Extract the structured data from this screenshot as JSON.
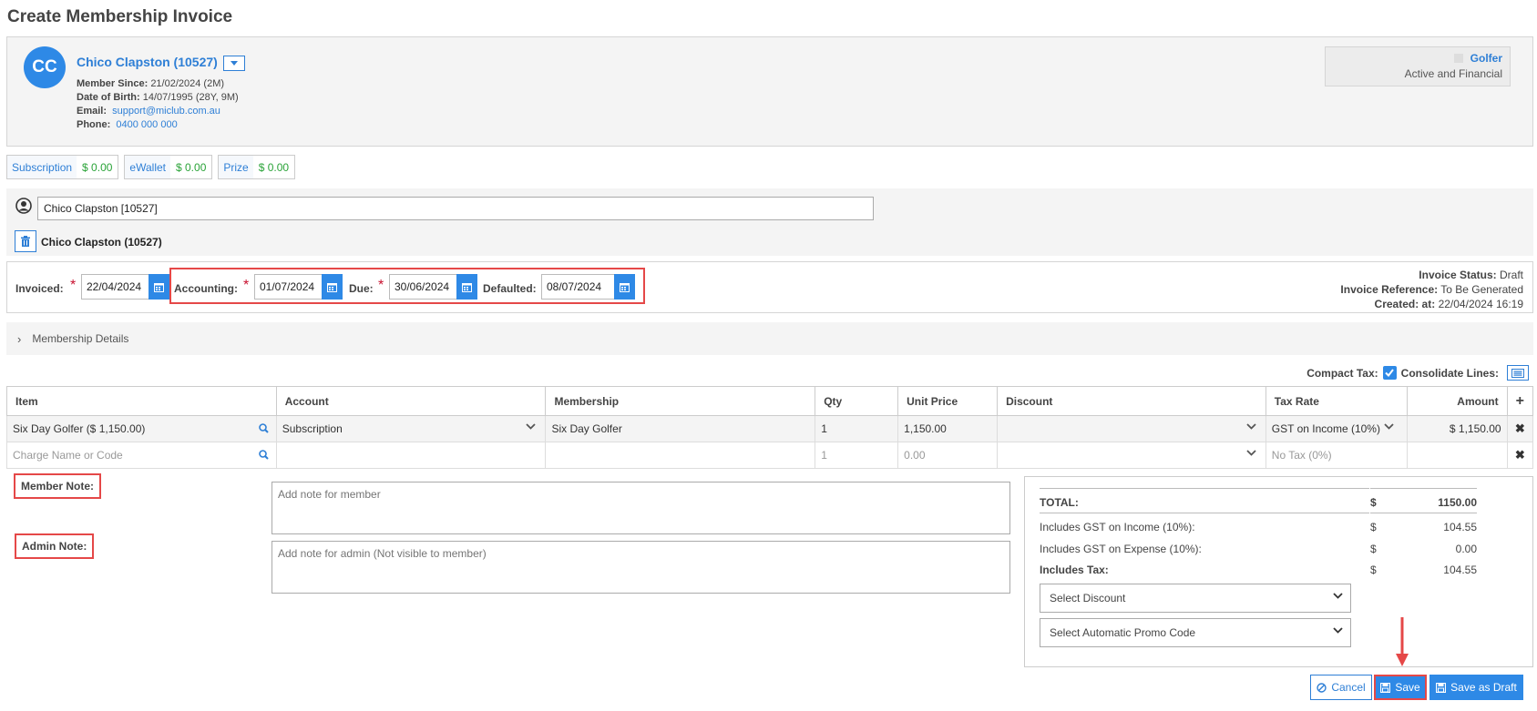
{
  "page_title": "Create Membership Invoice",
  "member": {
    "initials": "CC",
    "name": "Chico Clapston (10527)",
    "member_since_label": "Member Since:",
    "member_since": "21/02/2024 (2M)",
    "dob_label": "Date of Birth:",
    "dob": "14/07/1995 (28Y, 9M)",
    "email_label": "Email:",
    "email": "support@miclub.com.au",
    "phone_label": "Phone:",
    "phone": "0400 000 000",
    "category": "Golfer",
    "status": "Active and Financial"
  },
  "balances": [
    {
      "label": "Subscription",
      "value": "$ 0.00"
    },
    {
      "label": "eWallet",
      "value": "$ 0.00"
    },
    {
      "label": "Prize",
      "value": "$ 0.00"
    }
  ],
  "member_select": {
    "value": "Chico Clapston [10527]",
    "selected_name": "Chico Clapston  (10527)"
  },
  "dates": {
    "invoiced_label": "Invoiced:",
    "invoiced": "22/04/2024",
    "accounting_label": "Accounting:",
    "accounting": "01/07/2024",
    "due_label": "Due:",
    "due": "30/06/2024",
    "defaulted_label": "Defaulted:",
    "defaulted": "08/07/2024",
    "required_mark": "*"
  },
  "invoice_info": {
    "status_label": "Invoice Status:",
    "status": "Draft",
    "reference_label": "Invoice Reference:",
    "reference": "To Be Generated",
    "created_label": "Created:  at:",
    "created": "22/04/2024 16:19"
  },
  "membership_details_label": "Membership Details",
  "options": {
    "compact_tax_label": "Compact Tax:",
    "consolidate_label": "Consolidate Lines:"
  },
  "table": {
    "headers": [
      "Item",
      "Account",
      "Membership",
      "Qty",
      "Unit Price",
      "Discount",
      "Tax Rate",
      "Amount"
    ],
    "rows": [
      {
        "item": "Six Day Golfer ($ 1,150.00)",
        "account": "Subscription",
        "membership": "Six Day Golfer",
        "qty": "1",
        "unit_price": "1,150.00",
        "discount": "",
        "tax_rate": "GST on Income (10%)",
        "amount": "$ 1,150.00"
      }
    ],
    "new_row": {
      "item_placeholder": "Charge Name or Code",
      "qty": "1",
      "unit_price": "0.00",
      "tax_rate": "No Tax (0%)"
    }
  },
  "notes": {
    "member_label": "Member Note:",
    "member_placeholder": "Add note for member",
    "admin_label": "Admin Note:",
    "admin_placeholder": "Add note for admin (Not visible to member)"
  },
  "totals": {
    "currency": "$",
    "total_label": "TOTAL:",
    "total": "1150.00",
    "gst_income_label": "Includes GST on Income (10%):",
    "gst_income": "104.55",
    "gst_expense_label": "Includes GST on Expense (10%):",
    "gst_expense": "0.00",
    "tax_label": "Includes Tax:",
    "tax": "104.55",
    "discount_select": "Select Discount",
    "promo_select": "Select Automatic Promo Code"
  },
  "actions": {
    "cancel": "Cancel",
    "save": "Save",
    "save_draft": "Save as Draft"
  },
  "colors": {
    "accent": "#2e89e6",
    "link": "#2e7fd6",
    "highlight": "#e54848",
    "positive": "#2aa338",
    "danger": "#c8102e"
  }
}
